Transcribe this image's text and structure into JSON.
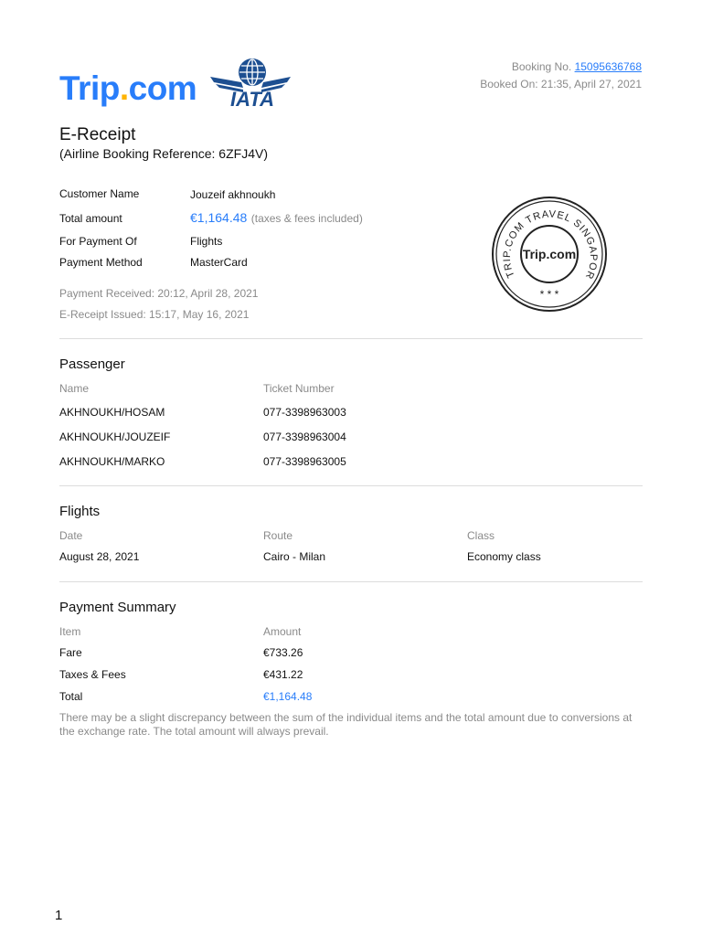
{
  "logo": {
    "brand": "Trip.com",
    "partner": "IATA"
  },
  "booking": {
    "no_label": "Booking No.",
    "no": "15095636768",
    "booked_on": "Booked On: 21:35, April 27, 2021"
  },
  "title": "E-Receipt",
  "reference": "(Airline Booking Reference: 6ZFJ4V)",
  "details": {
    "customer_label": "Customer Name",
    "customer": "Jouzeif akhnoukh",
    "total_label": "Total amount",
    "total": "€1,164.48",
    "total_note": "(taxes & fees included)",
    "for_label": "For Payment Of",
    "for": "Flights",
    "method_label": "Payment Method",
    "method": "MasterCard",
    "received": "Payment Received: 20:12, April 28, 2021",
    "issued": "E-Receipt Issued: 15:17, May 16, 2021"
  },
  "stamp": {
    "ring": "TRIP.COM TRAVEL SINGAPORE PTE.",
    "center": "Trip.com",
    "stars": "* * *"
  },
  "passenger": {
    "heading": "Passenger",
    "col_name": "Name",
    "col_ticket": "Ticket Number",
    "rows": [
      {
        "name": "AKHNOUKH/HOSAM",
        "ticket": "077-3398963003"
      },
      {
        "name": "AKHNOUKH/JOUZEIF",
        "ticket": "077-3398963004"
      },
      {
        "name": "AKHNOUKH/MARKO",
        "ticket": "077-3398963005"
      }
    ]
  },
  "flights": {
    "heading": "Flights",
    "col_date": "Date",
    "col_route": "Route",
    "col_class": "Class",
    "date": "August 28, 2021",
    "route": "Cairo - Milan",
    "class": "Economy class"
  },
  "payment": {
    "heading": "Payment Summary",
    "col_item": "Item",
    "col_amount": "Amount",
    "rows": [
      {
        "item": "Fare",
        "amount": "€733.26"
      },
      {
        "item": "Taxes & Fees",
        "amount": "€431.22"
      },
      {
        "item": "Total",
        "amount": "€1,164.48"
      }
    ],
    "note": "There may be a slight discrepancy between the sum of the individual items and the total amount due to conversions at the exchange rate. The total amount will always prevail."
  },
  "page_number": "1"
}
